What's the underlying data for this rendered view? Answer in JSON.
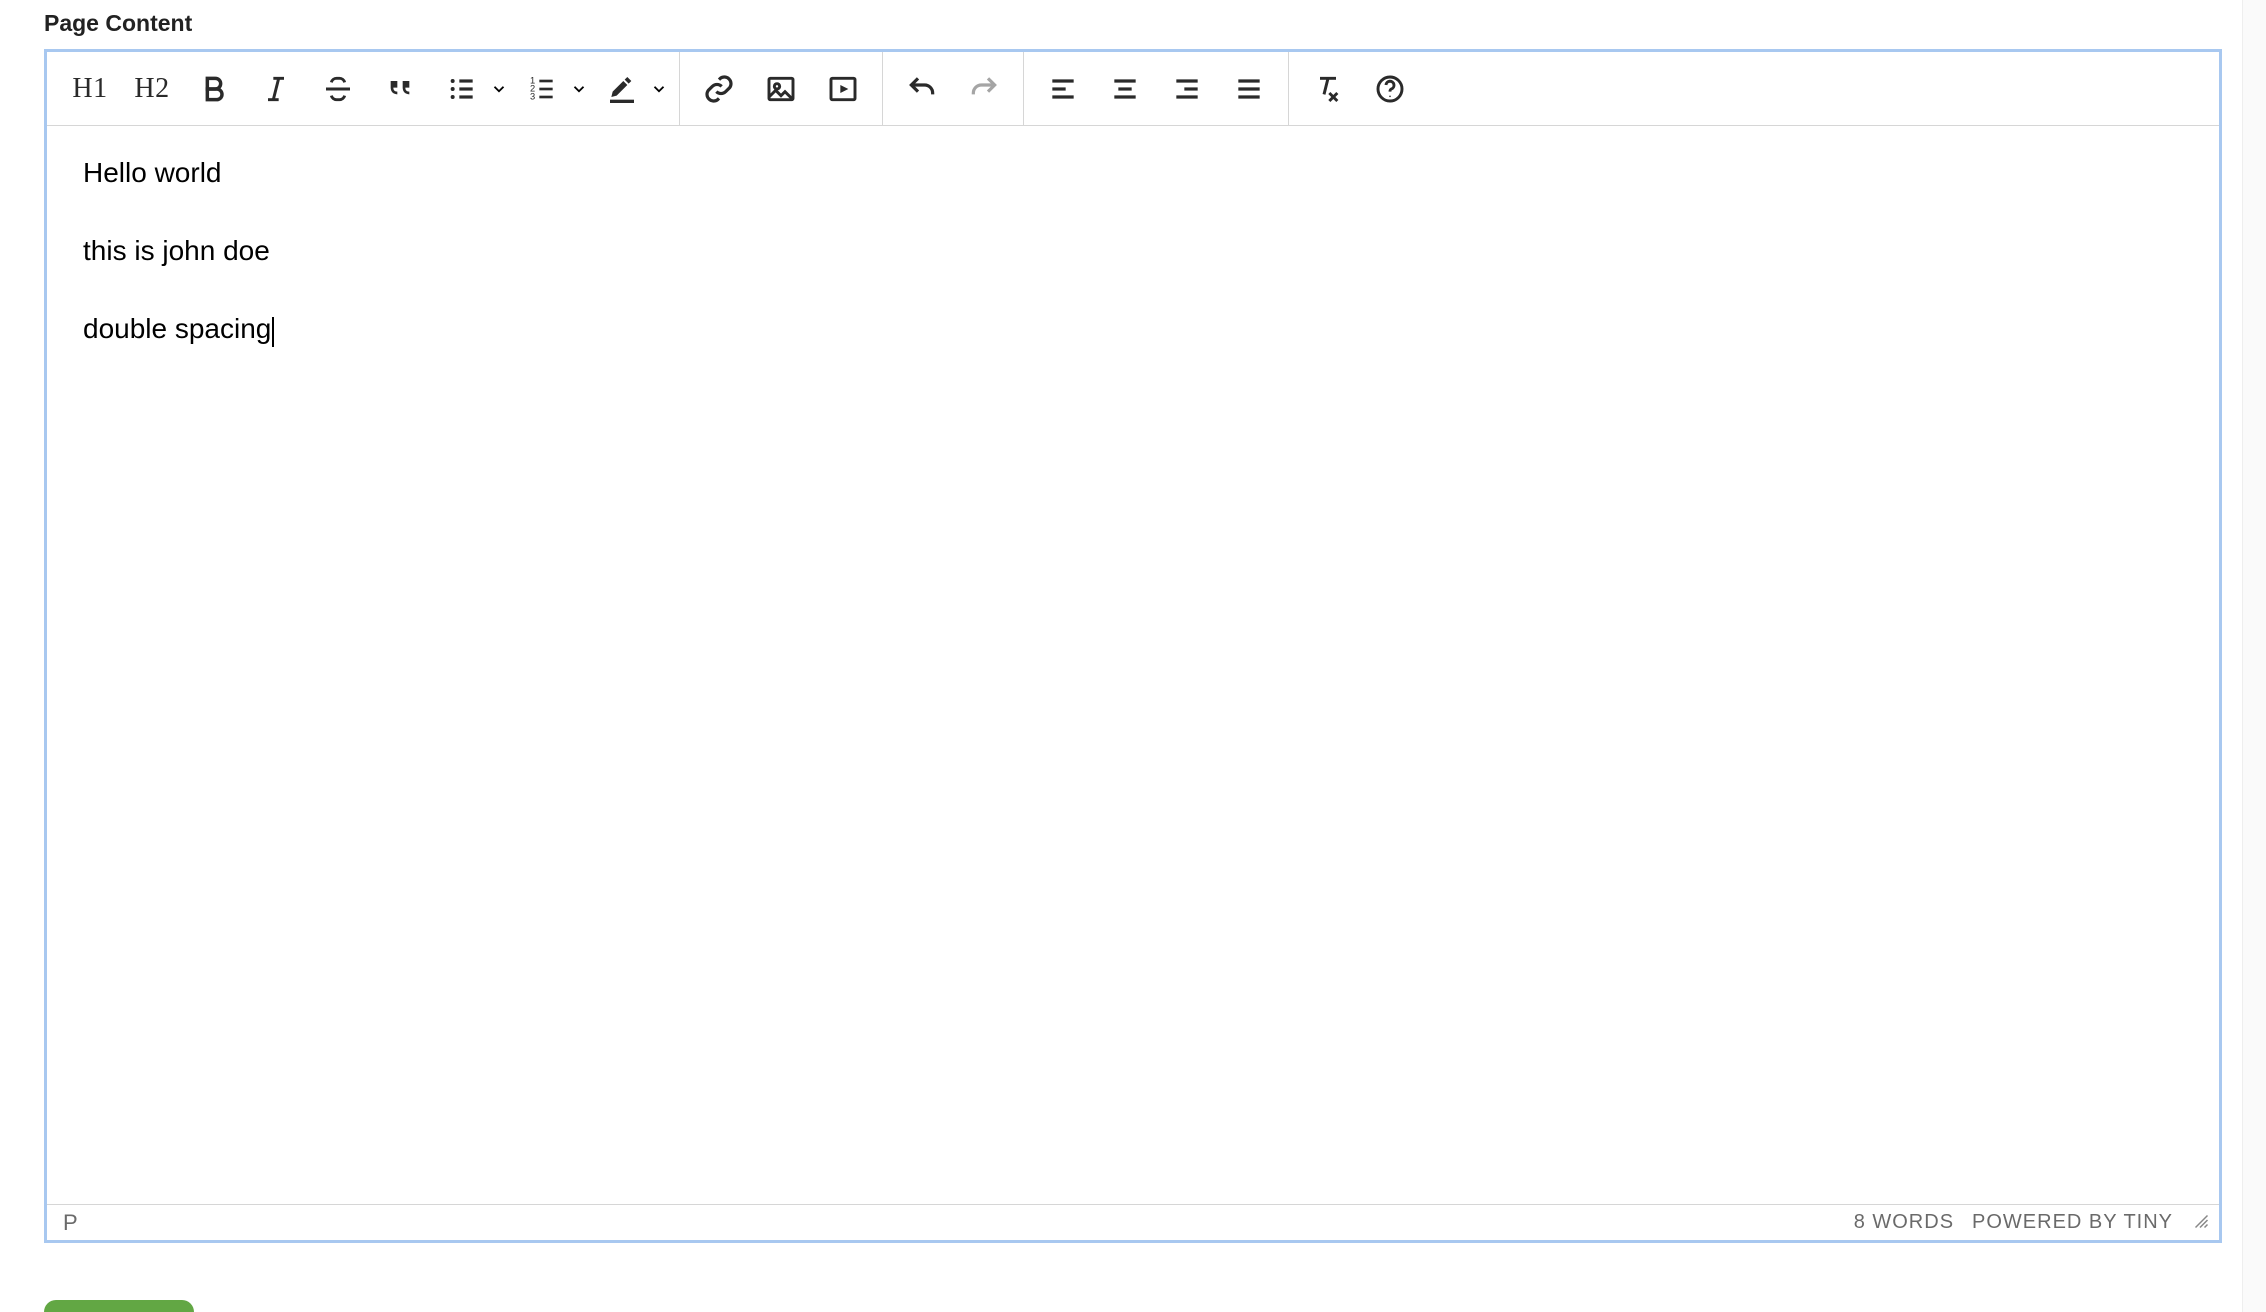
{
  "section_label": "Page Content",
  "toolbar": {
    "h1": "H1",
    "h2": "H2"
  },
  "content": {
    "p1": "Hello world",
    "p2": "this is john doe",
    "p3": "double spacing"
  },
  "status": {
    "path": "P",
    "word_count": "8 WORDS",
    "branding": "POWERED BY TINY"
  }
}
